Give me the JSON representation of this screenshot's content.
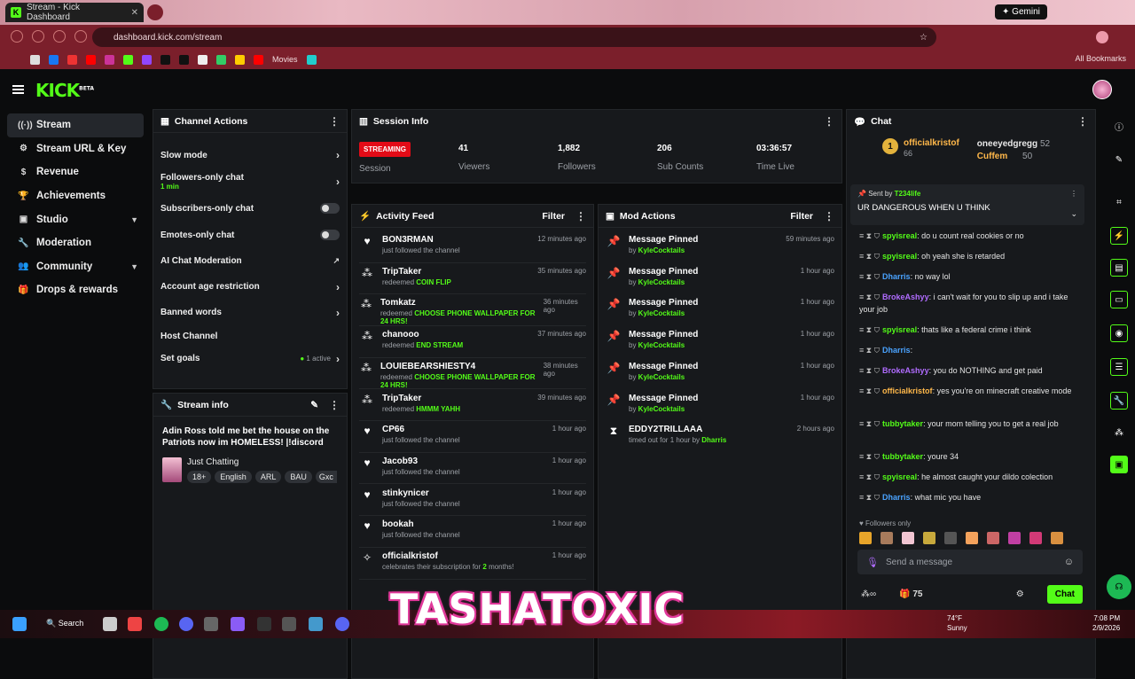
{
  "browser": {
    "tab_title": "Stream - Kick Dashboard",
    "url": "dashboard.kick.com/stream",
    "gemini_label": "Gemini",
    "bookmarks": [
      "Movies"
    ],
    "all_bookmarks_label": "All Bookmarks"
  },
  "logo": {
    "text": "KICK",
    "beta": "BETA"
  },
  "sidebar": {
    "items": [
      {
        "label": "Stream",
        "icon": "stream-icon"
      },
      {
        "label": "Stream URL & Key",
        "icon": "gear-icon"
      },
      {
        "label": "Revenue",
        "icon": "dollar-icon"
      },
      {
        "label": "Achievements",
        "icon": "trophy-icon"
      },
      {
        "label": "Studio",
        "icon": "studio-icon"
      },
      {
        "label": "Moderation",
        "icon": "wrench-icon"
      },
      {
        "label": "Community",
        "icon": "people-icon"
      },
      {
        "label": "Drops & rewards",
        "icon": "gift-icon"
      }
    ]
  },
  "channel_actions": {
    "title": "Channel Actions",
    "rows": [
      {
        "label": "Slow mode"
      },
      {
        "label": "Followers-only chat",
        "sub": "1 min"
      },
      {
        "label": "Subscribers-only chat"
      },
      {
        "label": "Emotes-only chat"
      },
      {
        "label": "AI Chat Moderation"
      },
      {
        "label": "Account age restriction"
      },
      {
        "label": "Banned words"
      },
      {
        "label": "Host Channel"
      },
      {
        "label": "Set goals",
        "status": "1 active"
      }
    ]
  },
  "stream_info": {
    "title": "Stream info",
    "stream_title": "Adin Ross told me bet the house on the Patriots now im HOMELESS! |!discord",
    "category": "Just Chatting",
    "tags": [
      "18+",
      "English",
      "ARL",
      "BAU",
      "Gxc"
    ]
  },
  "session_info": {
    "title": "Session Info",
    "status": "STREAMING",
    "status_label": "Session",
    "stats": [
      {
        "value": "41",
        "label": "Viewers"
      },
      {
        "value": "1,882",
        "label": "Followers"
      },
      {
        "value": "206",
        "label": "Sub Counts"
      },
      {
        "value": "03:36:57",
        "label": "Time Live"
      }
    ]
  },
  "activity_feed": {
    "title": "Activity Feed",
    "filter": "Filter",
    "items": [
      {
        "name": "BON3RMAN",
        "desc": "just followed the channel",
        "time": "12 minutes ago",
        "icon": "heart-icon"
      },
      {
        "name": "TripTaker",
        "desc": "redeemed",
        "highlight": "COIN FLIP",
        "time": "35 minutes ago",
        "icon": "reward-icon"
      },
      {
        "name": "Tomkatz",
        "desc": "redeemed",
        "highlight": "CHOOSE PHONE WALLPAPER FOR 24 HRS!",
        "time": "36 minutes ago",
        "icon": "reward-icon"
      },
      {
        "name": "chanooo",
        "desc": "redeemed",
        "highlight": "END STREAM",
        "time": "37 minutes ago",
        "icon": "reward-icon"
      },
      {
        "name": "LOUIEBEARSHIESTY4",
        "desc": "redeemed",
        "highlight": "CHOOSE PHONE WALLPAPER FOR 24 HRS!",
        "time": "38 minutes ago",
        "icon": "reward-icon"
      },
      {
        "name": "TripTaker",
        "desc": "redeemed",
        "highlight": "HMMM YAHH",
        "time": "39 minutes ago",
        "icon": "reward-icon"
      },
      {
        "name": "CP66",
        "desc": "just followed the channel",
        "time": "1 hour ago",
        "icon": "heart-icon"
      },
      {
        "name": "Jacob93",
        "desc": "just followed the channel",
        "time": "1 hour ago",
        "icon": "heart-icon"
      },
      {
        "name": "stinkynicer",
        "desc": "just followed the channel",
        "time": "1 hour ago",
        "icon": "heart-icon"
      },
      {
        "name": "bookah",
        "desc": "just followed the channel",
        "time": "1 hour ago",
        "icon": "heart-icon"
      },
      {
        "name": "officialkristof",
        "desc": "celebrates their subscription for",
        "highlight": "2",
        "desc2": "months!",
        "time": "1 hour ago",
        "icon": "star-icon"
      }
    ]
  },
  "mod_actions": {
    "title": "Mod Actions",
    "filter": "Filter",
    "items": [
      {
        "name": "Message Pinned",
        "by": "by",
        "mod": "KyleCocktails",
        "time": "59 minutes ago",
        "icon": "pin-icon"
      },
      {
        "name": "Message Pinned",
        "by": "by",
        "mod": "KyleCocktails",
        "time": "1 hour ago",
        "icon": "pin-icon"
      },
      {
        "name": "Message Pinned",
        "by": "by",
        "mod": "KyleCocktails",
        "time": "1 hour ago",
        "icon": "pin-icon"
      },
      {
        "name": "Message Pinned",
        "by": "by",
        "mod": "KyleCocktails",
        "time": "1 hour ago",
        "icon": "pin-icon"
      },
      {
        "name": "Message Pinned",
        "by": "by",
        "mod": "KyleCocktails",
        "time": "1 hour ago",
        "icon": "pin-icon"
      },
      {
        "name": "Message Pinned",
        "by": "by",
        "mod": "KyleCocktails",
        "time": "1 hour ago",
        "icon": "pin-icon"
      },
      {
        "name": "EDDY2TRILLAAA",
        "by": "timed out for 1 hour by",
        "mod": "Dharris",
        "time": "2 hours ago",
        "icon": "hourglass-icon"
      }
    ]
  },
  "chat": {
    "title": "Chat",
    "leaderboard": [
      {
        "rank": "1",
        "name": "officialkristof",
        "score": "66"
      },
      {
        "name": "oneeyedgregg",
        "score": "52"
      },
      {
        "name": "Cuffem",
        "score": "50"
      }
    ],
    "pinned": {
      "sent_by_label": "Sent by",
      "sender": "T234life",
      "text": "UR DANGEROUS WHEN U THINK"
    },
    "messages": [
      {
        "user": "spyisreal",
        "color": "g",
        "text": ": do u count real cookies or no"
      },
      {
        "user": "spyisreal",
        "color": "g",
        "text": ": oh yeah she is retarded"
      },
      {
        "user": "Dharris",
        "color": "b",
        "text": ": no way lol"
      },
      {
        "user": "BrokeAshyy",
        "color": "p",
        "text": ": i can't wait for you to slip up and i take your job"
      },
      {
        "user": "spyisreal",
        "color": "g",
        "text": ": thats like a federal crime i think"
      },
      {
        "user": "Dharris",
        "color": "b",
        "text": ":"
      },
      {
        "user": "BrokeAshyy",
        "color": "p",
        "text": ": you do NOTHING and get paid"
      },
      {
        "user": "officialkristof",
        "color": "o",
        "text": ": yes you're on minecraft creative mode"
      },
      {
        "user": "tubbytaker",
        "color": "g",
        "text": ": your mom telling you to get a real job"
      },
      {
        "user": "tubbytaker",
        "color": "g",
        "text": ": youre 34"
      },
      {
        "user": "spyisreal",
        "color": "g",
        "text": ": he almost caught your dildo colection"
      },
      {
        "user": "Dharris",
        "color": "b",
        "text": ": what mic you have"
      }
    ],
    "followers_only": "Followers only",
    "input_placeholder": "Send a message",
    "points": "75",
    "send_label": "Chat"
  },
  "overlay_text": "TASHATOXIC",
  "taskbar": {
    "search_label": "Search",
    "weather_temp": "74°F",
    "weather_desc": "Sunny",
    "time": "7:08 PM",
    "date": "2/9/2026"
  }
}
